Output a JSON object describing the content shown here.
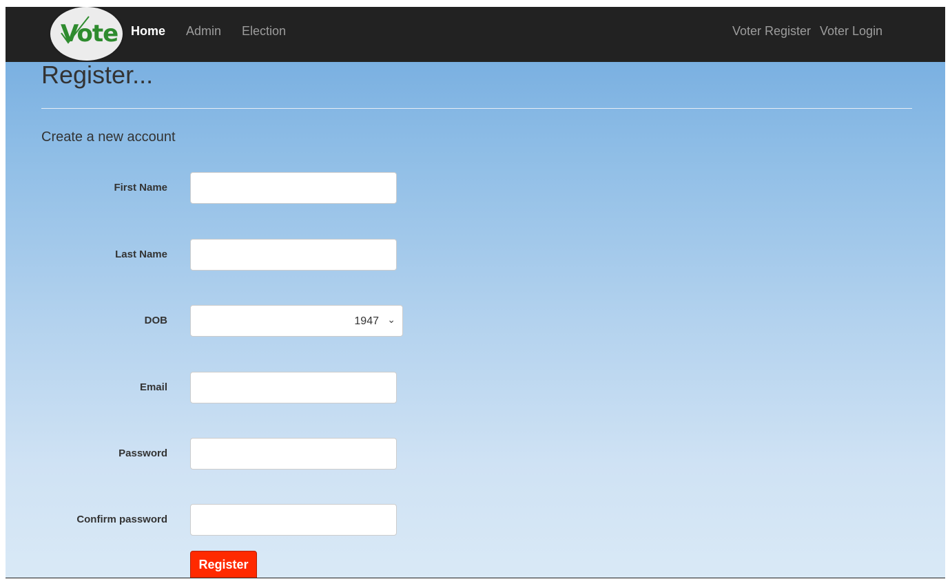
{
  "brand": {
    "logo_text": "Vote"
  },
  "nav": {
    "left": [
      {
        "label": "Home",
        "active": true
      },
      {
        "label": "Admin"
      },
      {
        "label": "Election"
      }
    ],
    "right": [
      {
        "label": "Voter Register"
      },
      {
        "label": "Voter Login"
      }
    ]
  },
  "page": {
    "title": "Register...",
    "subtitle": "Create a new account"
  },
  "form": {
    "first_name_label": "First Name",
    "first_name_value": "",
    "last_name_label": "Last Name",
    "last_name_value": "",
    "dob_label": "DOB",
    "dob_value": "1947",
    "email_label": "Email",
    "email_value": "",
    "password_label": "Password",
    "password_value": "",
    "confirm_password_label": "Confirm password",
    "confirm_password_value": "",
    "submit_label": "Register"
  },
  "colors": {
    "navbar_bg": "#222222",
    "brand_green": "#2e8b2e",
    "button_red": "#ff2a00",
    "nav_text": "#9d9d9d"
  }
}
